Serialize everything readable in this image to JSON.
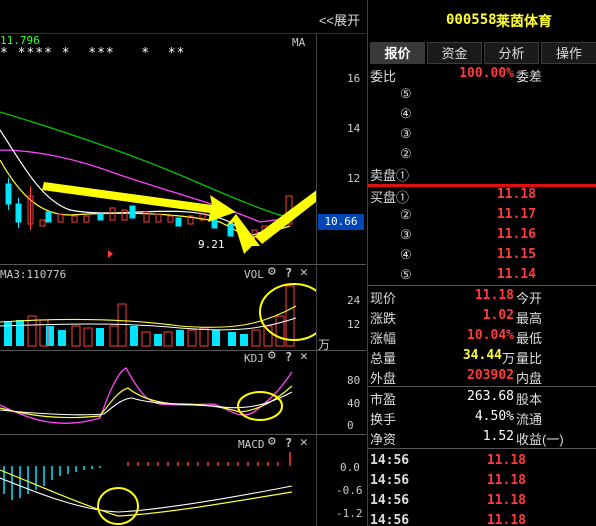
{
  "colors": {
    "up": "#ff3b3b",
    "down": "#00e5ff",
    "accent": "#ffff33",
    "panel_bg": "#000000"
  },
  "left": {
    "collapse_label": "<<展开",
    "price_label": "11.796",
    "stars": "* **** *  ***   *  **",
    "ma_label": "MA",
    "price_axis": [
      "16",
      "14",
      "12",
      "10.66"
    ],
    "low_marker": "9.21",
    "vol_header": "MA3:110776",
    "vol_label": "VOL",
    "vol_axis": [
      "24",
      "12",
      "万"
    ],
    "kdj_label": "KDJ",
    "kdj_axis": [
      "80",
      "40",
      "0"
    ],
    "macd_label": "MACD",
    "macd_axis": [
      "0.0",
      "-0.6",
      "-1.2"
    ]
  },
  "header": {
    "code": "000558",
    "name": "莱茵体育"
  },
  "tabs": [
    "报价",
    "资金",
    "分析",
    "操作"
  ],
  "order": {
    "ratio_label": "委比",
    "ratio_value": "100.00%",
    "diff_label": "委差",
    "sell": [
      "⑤",
      "④",
      "③",
      "②"
    ],
    "sell1_label": "卖盘①",
    "buy1_label": "买盘①",
    "buy1_price": "11.18",
    "buy": [
      {
        "label": "②",
        "price": "11.17"
      },
      {
        "label": "③",
        "price": "11.16"
      },
      {
        "label": "④",
        "price": "11.15"
      },
      {
        "label": "⑤",
        "price": "11.14"
      }
    ]
  },
  "quote": {
    "now_label": "现价",
    "now_value": "11.18",
    "open_label": "今开",
    "change_label": "涨跌",
    "change_value": "1.02",
    "high_label": "最高",
    "pct_label": "涨幅",
    "pct_value": "10.04%",
    "low_label": "最低",
    "vol_label": "总量",
    "vol_value": "34.44",
    "vol_unit": "万",
    "volratio_label": "量比",
    "outer_label": "外盘",
    "outer_value": "203902",
    "inner_label": "内盘"
  },
  "fund": {
    "pe_label": "市盈",
    "pe_value": "263.68",
    "equity_label": "股本",
    "turnover_label": "换手",
    "turnover_value": "4.50%",
    "float_label": "流通",
    "nav_label": "净资",
    "nav_value": "1.52",
    "eps_label": "收益(一)"
  },
  "ticks": [
    {
      "time": "14:56",
      "price": "11.18"
    },
    {
      "time": "14:56",
      "price": "11.18"
    },
    {
      "time": "14:56",
      "price": "11.18"
    },
    {
      "time": "14:56",
      "price": "11.18"
    }
  ]
}
